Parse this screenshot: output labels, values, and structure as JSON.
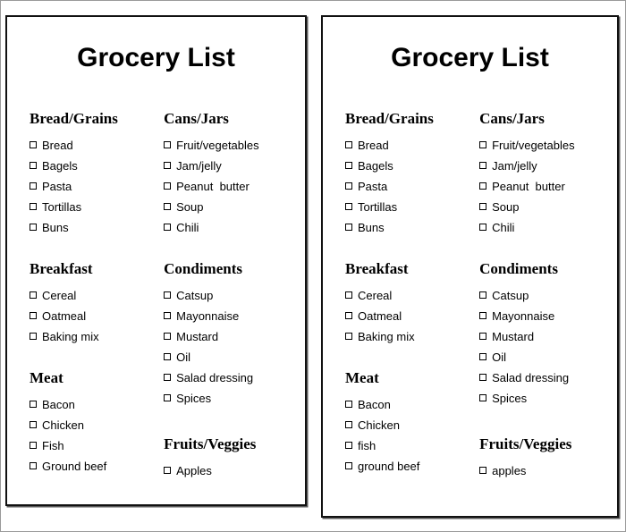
{
  "document": {
    "kind": "grocery-list-printable",
    "sheet_count": 2
  },
  "sheets": [
    {
      "id": "sheet-left",
      "title": "Grocery List",
      "column_a": [
        {
          "heading": "Bread/Grains",
          "items": [
            "Bread",
            "Bagels",
            "Pasta",
            "Tortillas",
            "Buns"
          ]
        },
        {
          "heading": "Breakfast",
          "items": [
            "Cereal",
            "Oatmeal",
            "Baking mix"
          ]
        },
        {
          "heading": "Meat",
          "items": [
            "Bacon",
            "Chicken",
            "Fish",
            "Ground beef"
          ]
        }
      ],
      "column_b": [
        {
          "heading": "Cans/Jars",
          "items": [
            "Fruit/vegetables",
            "Jam/jelly",
            "Peanut  butter",
            "Soup",
            "Chili"
          ]
        },
        {
          "heading": "Condiments",
          "items": [
            "Catsup",
            "Mayonnaise",
            "Mustard",
            "Oil",
            "Salad dressing",
            "Spices"
          ]
        },
        {
          "heading": "Fruits/Veggies",
          "items": [
            "Apples"
          ]
        }
      ]
    },
    {
      "id": "sheet-right",
      "title": "Grocery List",
      "column_a": [
        {
          "heading": "Bread/Grains",
          "items": [
            "Bread",
            "Bagels",
            "Pasta",
            "Tortillas",
            "Buns"
          ]
        },
        {
          "heading": "Breakfast",
          "items": [
            "Cereal",
            "Oatmeal",
            "Baking mix"
          ]
        },
        {
          "heading": "Meat",
          "items": [
            "Bacon",
            "Chicken",
            "fish",
            "ground beef"
          ]
        }
      ],
      "column_b": [
        {
          "heading": "Cans/Jars",
          "items": [
            "Fruit/vegetables",
            "Jam/jelly",
            "Peanut  butter",
            "Soup",
            "Chili"
          ]
        },
        {
          "heading": "Condiments",
          "items": [
            "Catsup",
            "Mayonnaise",
            "Mustard",
            "Oil",
            "Salad dressing",
            "Spices"
          ]
        },
        {
          "heading": "Fruits/Veggies",
          "items": [
            "apples"
          ]
        }
      ]
    }
  ],
  "colors": {
    "page_background": "#ffffff",
    "sheet_border": "#111111",
    "outer_border": "#9a9a9a",
    "text": "#000000",
    "checkbox_border": "#000000"
  },
  "icons": {
    "checkbox": "checkbox-unchecked-icon"
  }
}
